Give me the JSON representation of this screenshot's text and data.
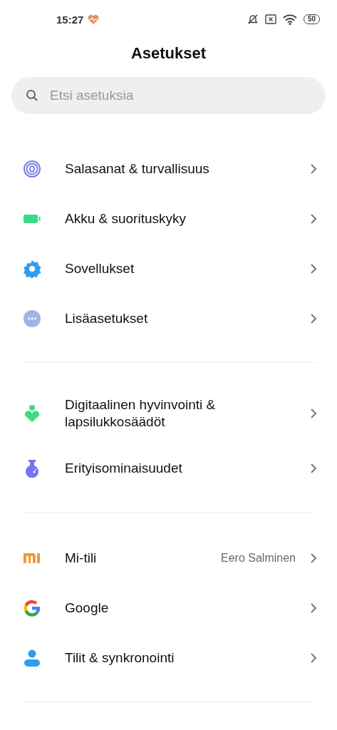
{
  "status_bar": {
    "time": "15:27",
    "battery": "50"
  },
  "title": "Asetukset",
  "search": {
    "placeholder": "Etsi asetuksia"
  },
  "sections": [
    {
      "items": [
        {
          "kind": "fingerprint",
          "label": "Salasanat & turvallisuus"
        },
        {
          "kind": "battery",
          "label": "Akku & suorituskyky"
        },
        {
          "kind": "gear",
          "label": "Sovellukset"
        },
        {
          "kind": "more",
          "label": "Lisäasetukset"
        }
      ]
    },
    {
      "items": [
        {
          "kind": "wellbeing",
          "label": "Digitaalinen hyvinvointi & lapsilukkosäädöt"
        },
        {
          "kind": "flask",
          "label": "Erityisominaisuudet"
        }
      ]
    },
    {
      "items": [
        {
          "kind": "mi",
          "label": "Mi-tili",
          "value": "Eero Salminen"
        },
        {
          "kind": "google",
          "label": "Google"
        },
        {
          "kind": "person",
          "label": "Tilit & synkronointi"
        }
      ]
    }
  ]
}
